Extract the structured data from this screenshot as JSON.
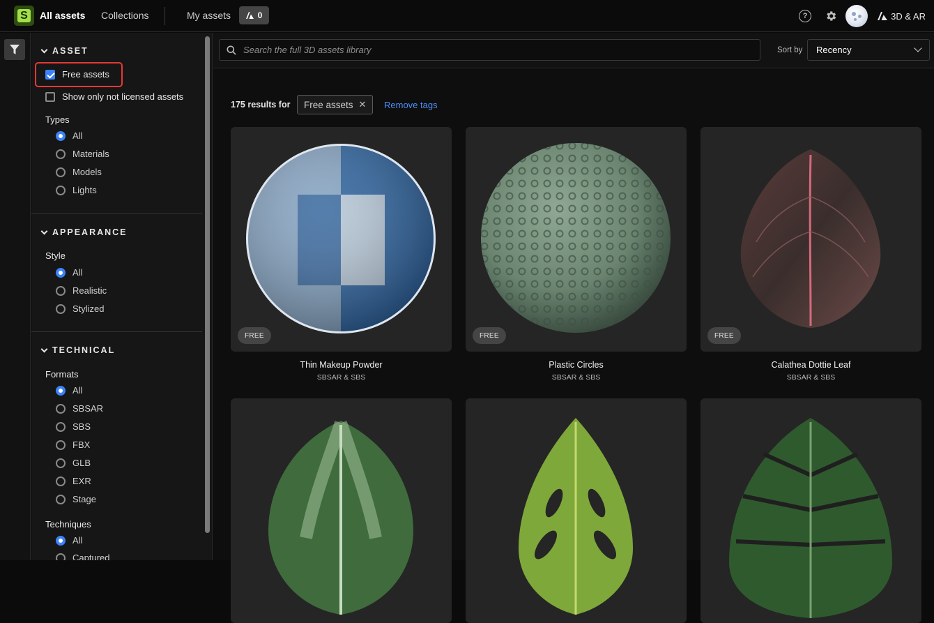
{
  "header": {
    "logo_letter": "S",
    "tabs": [
      {
        "label": "All assets",
        "active": true
      },
      {
        "label": "Collections",
        "active": false
      }
    ],
    "my_assets_label": "My assets",
    "cart_count": "0",
    "help_label": "?",
    "app_label": "3D & AR"
  },
  "sidebar": {
    "asset": {
      "title": "ASSET",
      "free_assets_label": "Free assets",
      "free_assets_checked": true,
      "not_licensed_label": "Show only not licensed assets",
      "not_licensed_checked": false,
      "types_label": "Types",
      "types": [
        "All",
        "Materials",
        "Models",
        "Lights"
      ],
      "types_selected": "All"
    },
    "appearance": {
      "title": "APPEARANCE",
      "style_label": "Style",
      "styles": [
        "All",
        "Realistic",
        "Stylized"
      ],
      "style_selected": "All"
    },
    "technical": {
      "title": "TECHNICAL",
      "formats_label": "Formats",
      "formats": [
        "All",
        "SBSAR",
        "SBS",
        "FBX",
        "GLB",
        "EXR",
        "Stage"
      ],
      "format_selected": "All",
      "techniques_label": "Techniques",
      "techniques": [
        "All",
        "Captured"
      ],
      "technique_selected": "All"
    }
  },
  "main": {
    "search_placeholder": "Search the full 3D assets library",
    "sort_by_label": "Sort by",
    "sort_value": "Recency",
    "results_text": "175 results for",
    "active_tag": "Free assets",
    "remove_tags_label": "Remove tags",
    "free_badge": "FREE",
    "cards": [
      {
        "title": "Thin Makeup Powder",
        "subtitle": "SBSAR & SBS",
        "free": true
      },
      {
        "title": "Plastic Circles",
        "subtitle": "SBSAR & SBS",
        "free": true
      },
      {
        "title": "Calathea Dottie Leaf",
        "subtitle": "SBSAR & SBS",
        "free": true
      },
      {
        "title": "",
        "subtitle": "",
        "free": false
      },
      {
        "title": "",
        "subtitle": "",
        "free": false
      },
      {
        "title": "",
        "subtitle": "",
        "free": false
      }
    ]
  },
  "colors": {
    "accent_blue": "#3b82f6",
    "link_blue": "#4c8ff7",
    "highlight_red": "#e53935",
    "logo_green": "#a4e04a"
  }
}
